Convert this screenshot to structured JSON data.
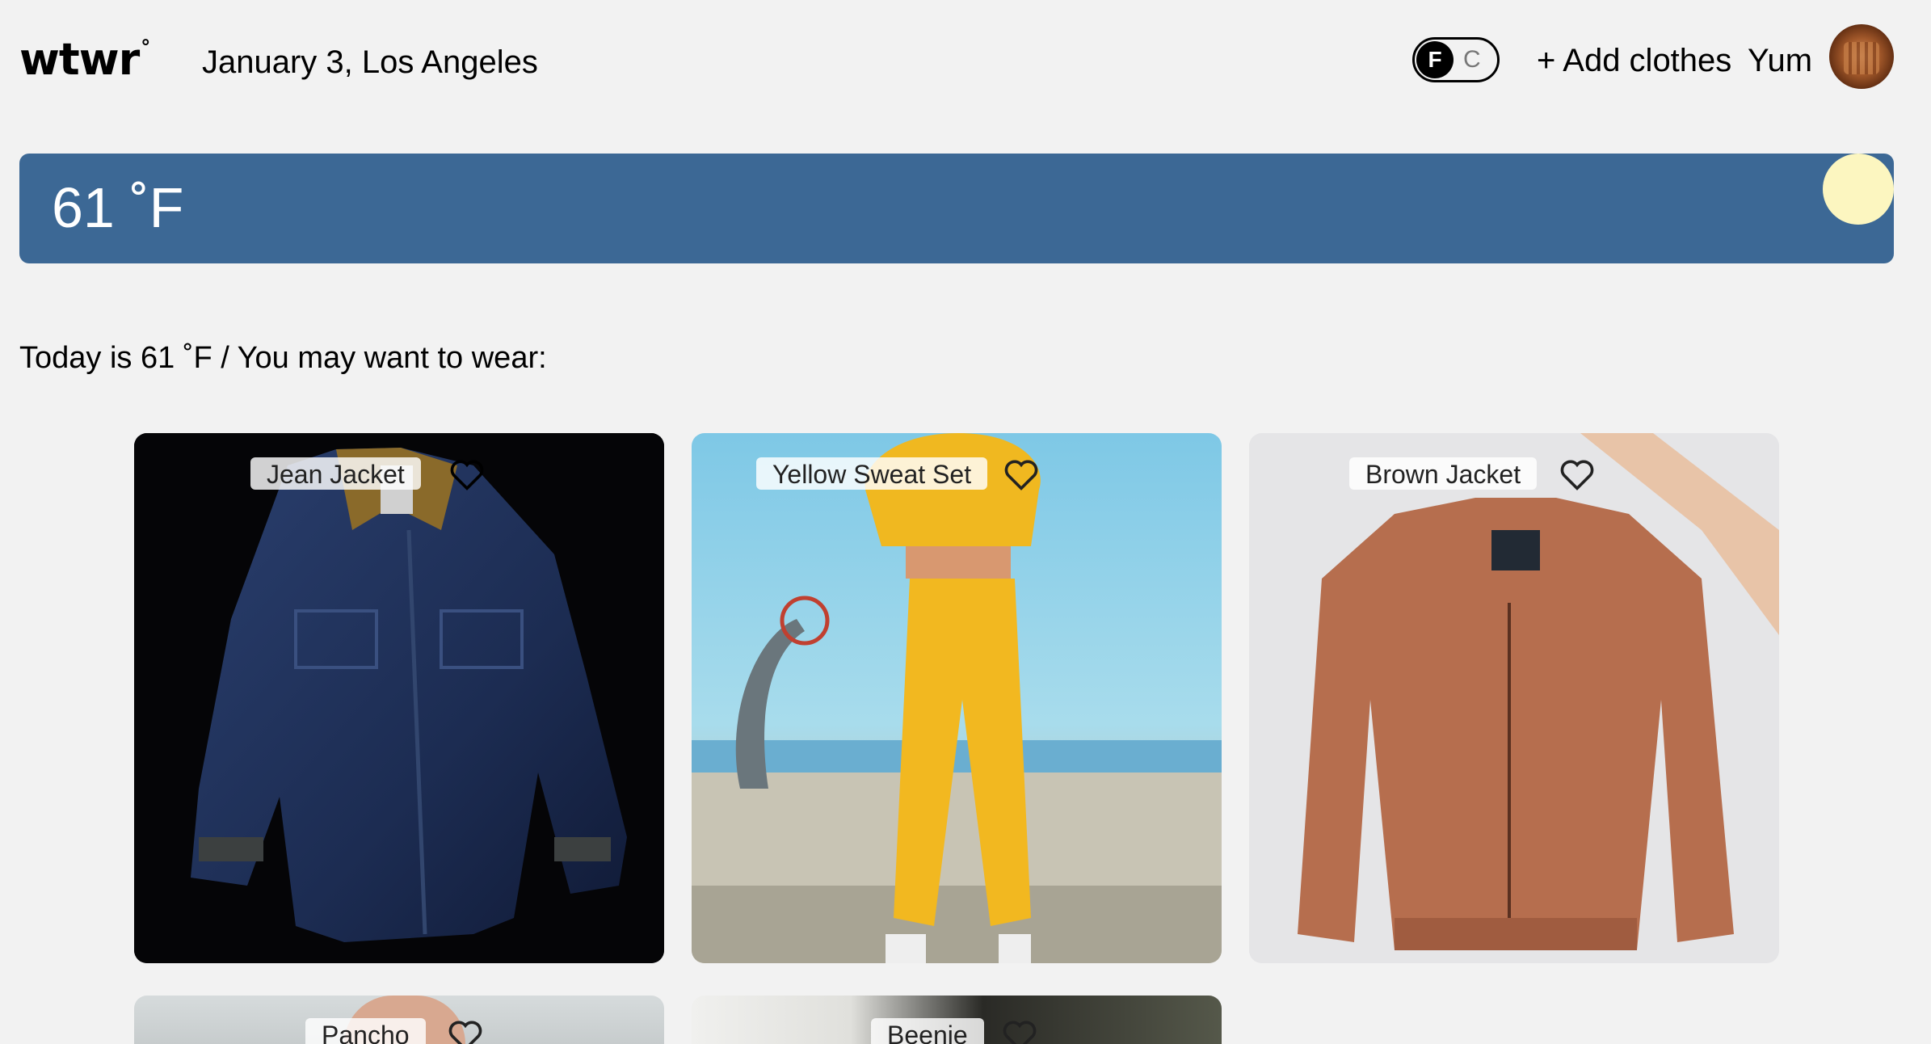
{
  "header": {
    "logo": "wtwr",
    "logo_mark": "°",
    "date_location": "January 3, Los Angeles",
    "unit_toggle": {
      "active": "F",
      "inactive": "C"
    },
    "add_clothes": "+ Add clothes",
    "username": "Yum"
  },
  "weather": {
    "temperature": "61 ˚F",
    "card_color": "#3c6895",
    "sun_color": "#fcf6c0"
  },
  "main": {
    "heading": "Today is 61 ˚F / You may want to wear:"
  },
  "items": [
    {
      "name": "Jean Jacket",
      "liked": false
    },
    {
      "name": "Yellow Sweat Set",
      "liked": false
    },
    {
      "name": "Brown Jacket",
      "liked": false
    },
    {
      "name": "Pancho",
      "liked": false
    },
    {
      "name": "Beenie",
      "liked": false
    }
  ],
  "icons": {
    "like": "heart-icon",
    "avatar": "user-avatar"
  }
}
